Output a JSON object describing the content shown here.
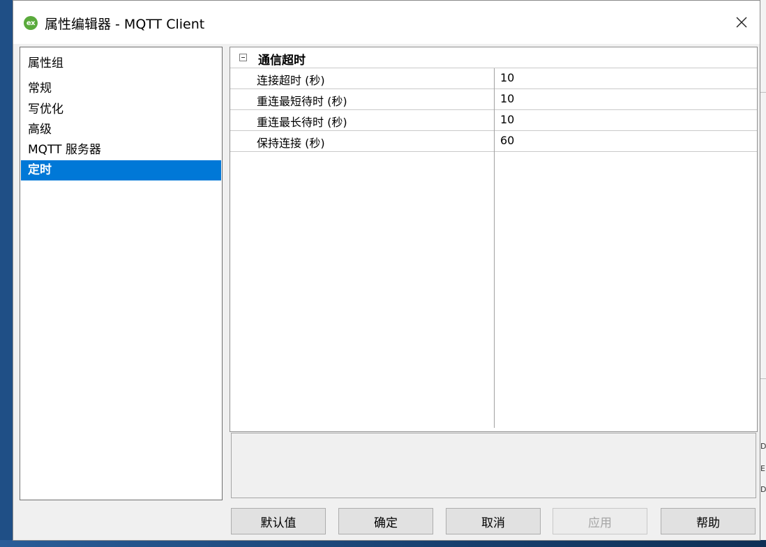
{
  "window": {
    "icon_text": "ex",
    "title": "属性编辑器 - MQTT Client",
    "close_symbol": "✕"
  },
  "groups": {
    "items": [
      {
        "label": "属性组",
        "selected": false
      },
      {
        "label": "常规",
        "selected": false
      },
      {
        "label": "写优化",
        "selected": false
      },
      {
        "label": "高级",
        "selected": false
      },
      {
        "label": "MQTT 服务器",
        "selected": false
      },
      {
        "label": "定时",
        "selected": true
      }
    ]
  },
  "property_grid": {
    "category": "通信超时",
    "rows": [
      {
        "name": "连接超时 (秒)",
        "value": "10"
      },
      {
        "name": "重连最短待时 (秒)",
        "value": "10"
      },
      {
        "name": "重连最长待时 (秒)",
        "value": "10"
      },
      {
        "name": "保持连接 (秒)",
        "value": "60"
      }
    ]
  },
  "buttons": {
    "default": "默认值",
    "ok": "确定",
    "cancel": "取消",
    "apply": "应用",
    "help": "帮助"
  },
  "desktop_edge": {
    "glyphs": [
      "D",
      "E",
      "D"
    ]
  },
  "colors": {
    "selection": "#0078d7",
    "app_icon": "#5aaa3c"
  }
}
